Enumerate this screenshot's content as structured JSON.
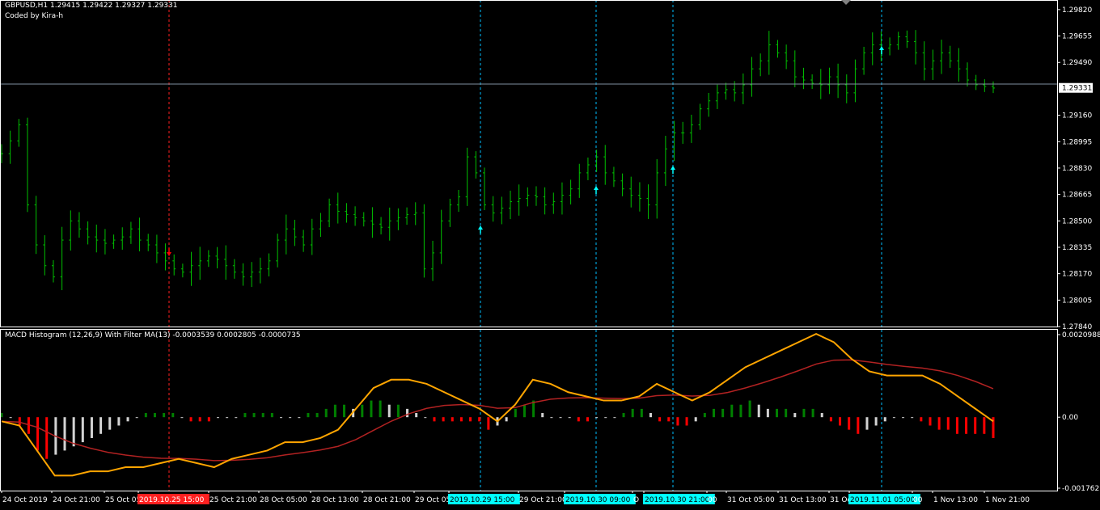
{
  "header": {
    "symbol_line": "GBPUSD,H1  1.29415 1.29422 1.29327 1.29331",
    "credit": "Coded by Kira-h"
  },
  "price_axis": {
    "ticks": [
      "1.29820",
      "1.29655",
      "1.29490",
      "1.29160",
      "1.28995",
      "1.28830",
      "1.28665",
      "1.28500",
      "1.28335",
      "1.28170",
      "1.28005",
      "1.27840"
    ],
    "current": "1.29331"
  },
  "indicator": {
    "title": "MACD Histogram (12,26,9) With Filter MA(13) -0.0003539 0.0002805 -0.0000735",
    "axis_top": "0.0020988",
    "axis_zero": "0.00",
    "axis_bottom": "-0.001762"
  },
  "time_axis": [
    {
      "text": "24 Oct 2019",
      "hl": ""
    },
    {
      "text": "24 Oct 21:00",
      "hl": ""
    },
    {
      "text": "25 Oct 05",
      "hl": ""
    },
    {
      "text": "2019.10.25 15:00",
      "hl": "red"
    },
    {
      "text": "25 Oct 21:00",
      "hl": ""
    },
    {
      "text": "28 Oct 05:00",
      "hl": ""
    },
    {
      "text": "28 Oct 13:00",
      "hl": ""
    },
    {
      "text": "28 Oct 21:00",
      "hl": ""
    },
    {
      "text": "29 Oct 05",
      "hl": ""
    },
    {
      "text": "2019.10.29 15:00",
      "hl": "cyan"
    },
    {
      "text": "29 Oct 21:00",
      "hl": ""
    },
    {
      "text": "2019.10.30 09:00",
      "hl": "cyan"
    },
    {
      "text": "O",
      "hl": ""
    },
    {
      "text": "2019.10.30 21:00",
      "hl": "cyan"
    },
    {
      "text": "00",
      "hl": ""
    },
    {
      "text": "31 Oct 05:00",
      "hl": ""
    },
    {
      "text": "31 Oct 13:00",
      "hl": ""
    },
    {
      "text": "31 Oc",
      "hl": ""
    },
    {
      "text": "2019.11.01 05:00",
      "hl": "cyan"
    },
    {
      "text": "00",
      "hl": ""
    },
    {
      "text": "1 Nov 13:00",
      "hl": ""
    },
    {
      "text": "1 Nov 21:00",
      "hl": ""
    }
  ],
  "colors": {
    "background": "#000000",
    "bars": "#00c000",
    "grid_border": "#ffffff",
    "current_line": "#8090a0",
    "buy_arrow": "#00ffff",
    "sell_arrow": "#ff0000",
    "macd_line": "#ffa500",
    "signal_line": "#b22222",
    "hist_up": "#008000",
    "hist_down": "#ff0000",
    "hist_neutral": "#d3d3d3",
    "vline_cyan": "#00bfff",
    "vline_red": "#ff2020"
  },
  "chart_data": {
    "type": "line",
    "title": "GBPUSD,H1",
    "ylim": [
      1.2784,
      1.2988
    ],
    "current_price": 1.29331,
    "signals": [
      {
        "type": "sell",
        "time": "2019.10.25 15:00"
      },
      {
        "type": "buy",
        "time": "2019.10.29 15:00"
      },
      {
        "type": "buy",
        "time": "2019.10.30 09:00"
      },
      {
        "type": "buy",
        "time": "2019.10.30 21:00"
      },
      {
        "type": "buy",
        "time": "2019.11.01 05:00"
      }
    ],
    "price_path": [
      1.2892,
      1.29,
      1.291,
      1.286,
      1.2835,
      1.2822,
      1.2815,
      1.2838,
      1.285,
      1.2845,
      1.284,
      1.2838,
      1.2836,
      1.2838,
      1.284,
      1.2845,
      1.2838,
      1.2835,
      1.283,
      1.2825,
      1.282,
      1.2818,
      1.2822,
      1.2825,
      1.2828,
      1.2826,
      1.2822,
      1.2818,
      1.2815,
      1.2818,
      1.282,
      1.2825,
      1.2838,
      1.2845,
      1.284,
      1.2835,
      1.2845,
      1.285,
      1.286,
      1.2856,
      1.2854,
      1.2852,
      1.285,
      1.2848,
      1.2846,
      1.285,
      1.2852,
      1.2854,
      1.2855,
      1.282,
      1.283,
      1.285,
      1.286,
      1.2865,
      1.289,
      1.288,
      1.286,
      1.2855,
      1.2858,
      1.2862,
      1.2864,
      1.2866,
      1.2865,
      1.286,
      1.2862,
      1.2866,
      1.287,
      1.288,
      1.2885,
      1.289,
      1.288,
      1.2875,
      1.287,
      1.2866,
      1.2864,
      1.286,
      1.288,
      1.2895,
      1.2905,
      1.2905,
      1.291,
      1.292,
      1.2925,
      1.293,
      1.2932,
      1.293,
      1.2935,
      1.2945,
      1.295,
      1.296,
      1.2955,
      1.295,
      1.294,
      1.2938,
      1.2936,
      1.2935,
      1.294,
      1.2935,
      1.293,
      1.2945,
      1.2955,
      1.296,
      1.2958,
      1.296,
      1.2965,
      1.2962,
      1.2955,
      1.2945,
      1.295,
      1.2955,
      1.295,
      1.2945,
      1.2938,
      1.2935,
      1.2934,
      1.2933
    ],
    "macd_hist": [
      0.0001,
      0.0,
      -0.0002,
      -0.0004,
      -0.0008,
      -0.001,
      -0.0009,
      -0.0008,
      -0.0007,
      -0.0006,
      -0.0005,
      -0.0004,
      -0.0003,
      -0.0002,
      -0.0001,
      0.0,
      0.0001,
      0.0001,
      0.0001,
      0.0001,
      0.0,
      -0.0001,
      -0.0001,
      -0.0001,
      0.0,
      0.0,
      0.0,
      0.0001,
      0.0001,
      0.0001,
      0.0001,
      0.0,
      0.0,
      0.0,
      0.0001,
      0.0001,
      0.0002,
      0.0003,
      0.0003,
      0.0002,
      0.0003,
      0.0004,
      0.0004,
      0.0003,
      0.0003,
      0.0002,
      0.0001,
      0.0,
      -0.0001,
      -0.0001,
      -0.0001,
      -0.0001,
      -0.0001,
      -0.0001,
      -0.0003,
      -0.0002,
      -0.0001,
      0.0002,
      0.0003,
      0.0004,
      0.0001,
      0.0,
      0.0,
      0.0,
      -0.0001,
      -0.0001,
      0.0,
      0.0,
      0.0,
      0.0001,
      0.0002,
      0.0002,
      0.0001,
      -0.0001,
      -0.0001,
      -0.0002,
      -0.0002,
      -0.0001,
      0.0001,
      0.0002,
      0.0002,
      0.0003,
      0.0003,
      0.0004,
      0.0003,
      0.0002,
      0.0002,
      0.0002,
      0.0001,
      0.0002,
      0.0002,
      0.0001,
      -0.0001,
      -0.0002,
      -0.0003,
      -0.0004,
      -0.0003,
      -0.0002,
      -0.0001,
      0.0,
      0.0,
      0.0,
      -0.0001,
      -0.0002,
      -0.0003,
      -0.0003,
      -0.0004,
      -0.0004,
      -0.0004,
      -0.0004,
      -0.0005
    ],
    "macd_line": [
      -0.0001,
      -0.0002,
      -0.0008,
      -0.0014,
      -0.0014,
      -0.0013,
      -0.0013,
      -0.0012,
      -0.0012,
      -0.0011,
      -0.001,
      -0.0011,
      -0.0012,
      -0.001,
      -0.0009,
      -0.0008,
      -0.0006,
      -0.0006,
      -0.0005,
      -0.0003,
      0.0002,
      0.0007,
      0.0009,
      0.0009,
      0.0008,
      0.0006,
      0.0004,
      0.0002,
      -0.0001,
      0.0003,
      0.0009,
      0.0008,
      0.0006,
      0.0005,
      0.0004,
      0.0004,
      0.0005,
      0.0008,
      0.0006,
      0.0004,
      0.0006,
      0.0009,
      0.0012,
      0.0014,
      0.0016,
      0.0018,
      0.002,
      0.0018,
      0.0014,
      0.0011,
      0.001,
      0.001,
      0.001,
      0.0008,
      0.0005,
      0.0002,
      -0.0001
    ]
  }
}
